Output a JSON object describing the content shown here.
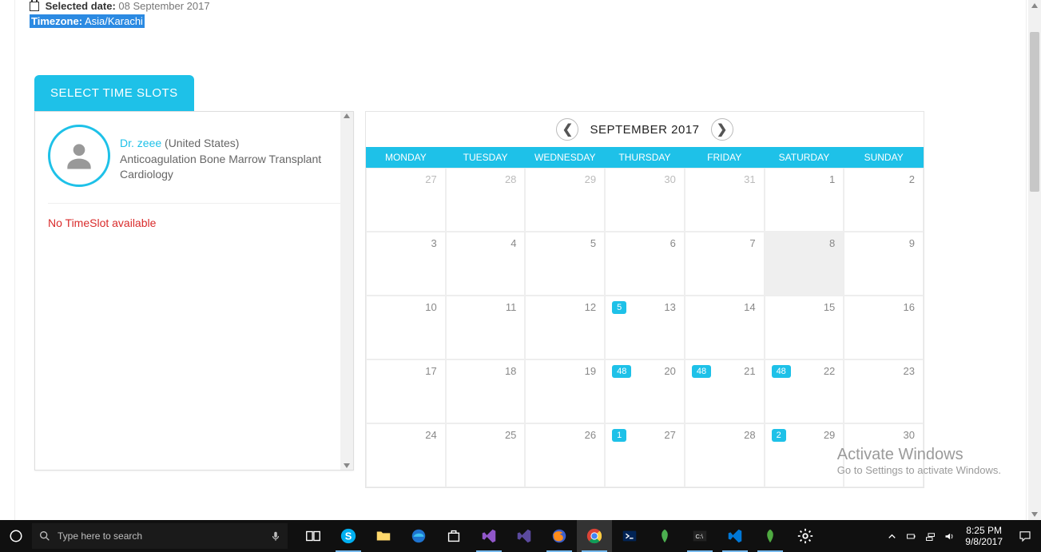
{
  "header": {
    "selected_label": "Selected date:",
    "selected_value": "08 September 2017",
    "timezone_label": "Timezone:",
    "timezone_value": "Asia/Karachi"
  },
  "tab": {
    "label": "SELECT TIME SLOTS"
  },
  "doctor": {
    "name": "Dr. zeee",
    "location": "(United States)",
    "specialties": "Anticoagulation Bone Marrow Transplant Cardiology"
  },
  "noslot": "No TimeSlot available",
  "calendar": {
    "month": "SEPTEMBER 2017",
    "weekdays": [
      "MONDAY",
      "TUESDAY",
      "WEDNESDAY",
      "THURSDAY",
      "FRIDAY",
      "SATURDAY",
      "SUNDAY"
    ],
    "cells": [
      {
        "n": "27",
        "other": true
      },
      {
        "n": "28",
        "other": true
      },
      {
        "n": "29",
        "other": true
      },
      {
        "n": "30",
        "other": true
      },
      {
        "n": "31",
        "other": true
      },
      {
        "n": "1"
      },
      {
        "n": "2"
      },
      {
        "n": "3"
      },
      {
        "n": "4"
      },
      {
        "n": "5"
      },
      {
        "n": "6"
      },
      {
        "n": "7"
      },
      {
        "n": "8",
        "today": true
      },
      {
        "n": "9"
      },
      {
        "n": "10"
      },
      {
        "n": "11"
      },
      {
        "n": "12"
      },
      {
        "n": "13",
        "badge": "5"
      },
      {
        "n": "14"
      },
      {
        "n": "15"
      },
      {
        "n": "16"
      },
      {
        "n": "17"
      },
      {
        "n": "18"
      },
      {
        "n": "19"
      },
      {
        "n": "20",
        "badge": "48"
      },
      {
        "n": "21",
        "badge": "48"
      },
      {
        "n": "22",
        "badge": "48"
      },
      {
        "n": "23"
      },
      {
        "n": "24"
      },
      {
        "n": "25"
      },
      {
        "n": "26"
      },
      {
        "n": "27",
        "badge": "1"
      },
      {
        "n": "28"
      },
      {
        "n": "29",
        "badge": "2"
      },
      {
        "n": "30"
      }
    ]
  },
  "watermark": {
    "title": "Activate Windows",
    "sub": "Go to Settings to activate Windows."
  },
  "taskbar": {
    "search_placeholder": "Type here to search",
    "time": "8:25 PM",
    "date": "9/8/2017"
  }
}
